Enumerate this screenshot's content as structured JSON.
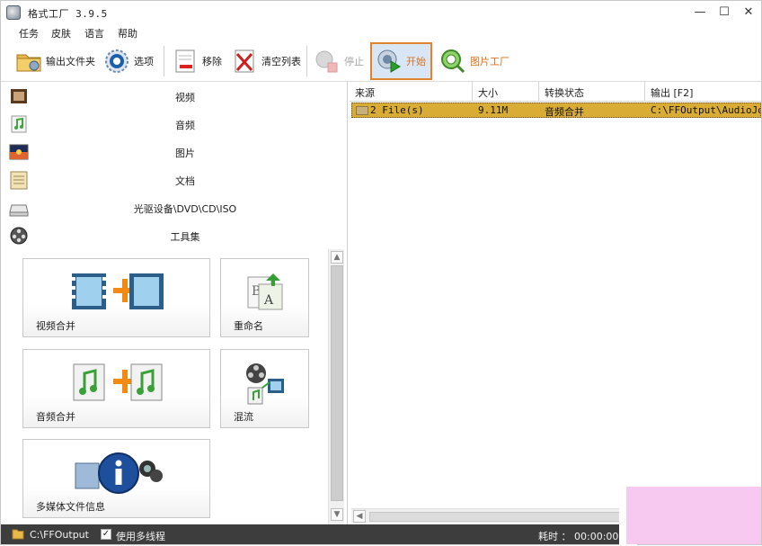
{
  "window": {
    "title": "格式工厂 3.9.5",
    "minimize": "—",
    "maximize": "☐",
    "close": "✕"
  },
  "menu": [
    "任务",
    "皮肤",
    "语言",
    "帮助"
  ],
  "toolbar": {
    "output_folder": "输出文件夹",
    "options": "选项",
    "remove": "移除",
    "clear_list": "清空列表",
    "stop": "停止",
    "start": "开始",
    "picture_factory": "图片工厂"
  },
  "categories": [
    "视频",
    "音频",
    "图片",
    "文档",
    "光驱设备\\DVD\\CD\\ISO",
    "工具集"
  ],
  "tools": {
    "video_merge": "视频合并",
    "rename": "重命名",
    "audio_merge": "音频合并",
    "mix": "混流",
    "media_info": "多媒体文件信息"
  },
  "table": {
    "headers": [
      "来源",
      "大小",
      "转换状态",
      "输出 [F2]"
    ],
    "rows": [
      {
        "source": "2 File(s)",
        "size": "9.11M",
        "status": "音频合并",
        "output": "C:\\FFOutput\\AudioJoi"
      }
    ]
  },
  "statusbar": {
    "output_path": "C:\\FFOutput",
    "multithread_label": "使用多线程",
    "multithread_checked": true,
    "elapsed": "耗时 ： 00:00:00"
  },
  "colors": {
    "accent_orange": "#e0832c",
    "row_highlight": "#d9ad35",
    "statusbar_bg": "#3d3d3d"
  }
}
